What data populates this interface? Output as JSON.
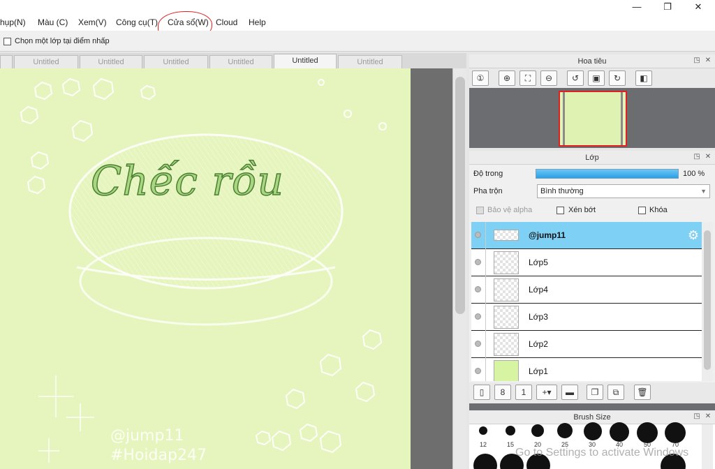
{
  "menu": {
    "items": [
      "hụp(N)",
      "Màu (C)",
      "Xem(V)",
      "Công cụ(T)",
      "Cửa sổ(W)",
      "Cloud",
      "Help"
    ]
  },
  "window_controls": {
    "minimize": "—",
    "restore": "❐",
    "close": "✕"
  },
  "options": {
    "select_layer_on_click": "Chọn một lớp tại điểm nhấp"
  },
  "tabs": [
    {
      "label": "Untitled",
      "active": false
    },
    {
      "label": "Untitled",
      "active": false
    },
    {
      "label": "Untitled",
      "active": false
    },
    {
      "label": "Untitled",
      "active": false
    },
    {
      "label": "Untitled",
      "active": true
    },
    {
      "label": "Untitled",
      "active": false
    }
  ],
  "artwork": {
    "title": "Chếc rồu",
    "handle": "@jump11",
    "tag": "#Hoidap247",
    "background_color": "#e6f5bd"
  },
  "navigator": {
    "title": "Hoa tiêu",
    "tools": [
      "zoom-actual-icon",
      "zoom-in-icon",
      "fit-icon",
      "zoom-out-icon",
      "rotate-left-icon",
      "fit-window-icon",
      "rotate-right-icon",
      "flip-icon"
    ]
  },
  "layers": {
    "title": "Lớp",
    "opacity_label": "Độ trong",
    "opacity_value": "100 %",
    "blend_label": "Pha trộn",
    "blend_value": "Bình thường",
    "protect_alpha": "Bảo vệ alpha",
    "clipping": "Xén bớt",
    "lock": "Khóa",
    "items": [
      {
        "name": "@jump11",
        "selected": true
      },
      {
        "name": "Lớp5",
        "selected": false
      },
      {
        "name": "Lớp4",
        "selected": false
      },
      {
        "name": "Lớp3",
        "selected": false
      },
      {
        "name": "Lớp2",
        "selected": false
      },
      {
        "name": "Lớp1",
        "selected": false
      }
    ]
  },
  "brush_size": {
    "title": "Brush Size",
    "sizes": [
      "12",
      "15",
      "20",
      "25",
      "30",
      "40",
      "50",
      "70"
    ]
  },
  "watermark": "Go to Settings to activate Windows"
}
